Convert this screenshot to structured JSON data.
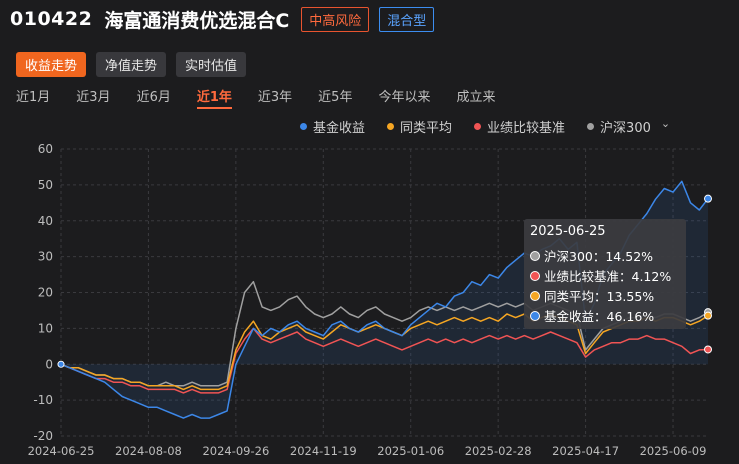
{
  "header": {
    "fund_code": "010422",
    "fund_name": "海富通消费优选混合C",
    "risk_tag": "中高风险",
    "type_tag": "混合型"
  },
  "view_buttons": [
    {
      "label": "收益走势",
      "active": true
    },
    {
      "label": "净值走势",
      "active": false
    },
    {
      "label": "实时估值",
      "active": false
    }
  ],
  "periods": [
    {
      "label": "近1月",
      "active": false
    },
    {
      "label": "近3月",
      "active": false
    },
    {
      "label": "近6月",
      "active": false
    },
    {
      "label": "近1年",
      "active": true
    },
    {
      "label": "近3年",
      "active": false
    },
    {
      "label": "近5年",
      "active": false
    },
    {
      "label": "今年以来",
      "active": false
    },
    {
      "label": "成立来",
      "active": false
    }
  ],
  "legend": [
    {
      "name": "基金收益",
      "color": "#3c87e8"
    },
    {
      "name": "同类平均",
      "color": "#f5a623"
    },
    {
      "name": "业绩比较基准",
      "color": "#f05454"
    },
    {
      "name": "沪深300",
      "color": "#a0a0a0"
    }
  ],
  "tooltip": {
    "date": "2025-06-25",
    "rows": [
      {
        "label": "沪深300：14.52%",
        "color": "#a0a0a0"
      },
      {
        "label": "业绩比较基准：4.12%",
        "color": "#f05454"
      },
      {
        "label": "同类平均：13.55%",
        "color": "#f5a623"
      },
      {
        "label": "基金收益：46.16%",
        "color": "#3c87e8"
      }
    ]
  },
  "chart_data": {
    "type": "line",
    "ylim": [
      -20,
      60
    ],
    "y_ticks": [
      60,
      50,
      40,
      30,
      20,
      10,
      0,
      -10,
      -20
    ],
    "x_tick_labels": [
      "2024-06-25",
      "2024-08-08",
      "2024-09-26",
      "2024-11-19",
      "2025-01-06",
      "2025-02-28",
      "2025-04-17",
      "2025-06-09"
    ],
    "x_tick_index": [
      0,
      10,
      20,
      30,
      40,
      50,
      60,
      70
    ],
    "n_points": 75,
    "series": [
      {
        "name": "基金收益",
        "color": "#3c87e8",
        "values": [
          0,
          -1,
          -2,
          -3,
          -4,
          -5,
          -7,
          -9,
          -10,
          -11,
          -12,
          -12,
          -13,
          -14,
          -15,
          -14,
          -15,
          -15,
          -14,
          -13,
          0,
          5,
          10,
          8,
          10,
          9,
          11,
          12,
          10,
          9,
          8,
          11,
          12,
          10,
          9,
          11,
          12,
          10,
          9,
          8,
          11,
          13,
          15,
          17,
          16,
          19,
          20,
          23,
          22,
          25,
          24,
          27,
          29,
          31,
          30,
          32,
          33,
          35,
          32,
          34,
          12,
          17,
          25,
          28,
          31,
          36,
          39,
          42,
          46,
          49,
          48,
          51,
          45,
          43,
          46.16
        ]
      },
      {
        "name": "同类平均",
        "color": "#f5a623",
        "values": [
          0,
          -1,
          -1,
          -2,
          -3,
          -3,
          -4,
          -4,
          -5,
          -5,
          -6,
          -6,
          -6,
          -6,
          -7,
          -6,
          -7,
          -7,
          -7,
          -6,
          4,
          9,
          12,
          8,
          7,
          9,
          10,
          11,
          9,
          8,
          7,
          9,
          11,
          10,
          9,
          10,
          11,
          10,
          9,
          8,
          10,
          11,
          12,
          11,
          12,
          13,
          12,
          13,
          12,
          13,
          12,
          14,
          13,
          14,
          12,
          13,
          14,
          13,
          12,
          11,
          3,
          6,
          9,
          10,
          11,
          12,
          12,
          13,
          12,
          13,
          13,
          12,
          11,
          12,
          13.55
        ]
      },
      {
        "name": "业绩比较基准",
        "color": "#f05454",
        "values": [
          0,
          -1,
          -2,
          -3,
          -4,
          -4,
          -5,
          -5,
          -6,
          -6,
          -7,
          -7,
          -7,
          -7,
          -8,
          -7,
          -8,
          -8,
          -8,
          -7,
          3,
          7,
          10,
          7,
          6,
          7,
          8,
          9,
          7,
          6,
          5,
          6,
          7,
          6,
          5,
          6,
          7,
          6,
          5,
          4,
          5,
          6,
          7,
          6,
          7,
          6,
          7,
          6,
          7,
          8,
          7,
          8,
          7,
          8,
          7,
          8,
          9,
          8,
          7,
          6,
          2,
          4,
          5,
          6,
          6,
          7,
          7,
          8,
          7,
          7,
          6,
          5,
          3,
          4,
          4.12
        ]
      },
      {
        "name": "沪深300",
        "color": "#a0a0a0",
        "values": [
          0,
          -1,
          -1,
          -2,
          -3,
          -3,
          -4,
          -4,
          -5,
          -5,
          -6,
          -6,
          -5,
          -6,
          -6,
          -5,
          -6,
          -6,
          -6,
          -5,
          10,
          20,
          23,
          16,
          15,
          16,
          18,
          19,
          16,
          14,
          13,
          14,
          16,
          14,
          13,
          15,
          16,
          14,
          13,
          12,
          13,
          15,
          16,
          15,
          16,
          15,
          16,
          15,
          16,
          17,
          16,
          17,
          16,
          17,
          15,
          16,
          17,
          16,
          15,
          14,
          4,
          7,
          10,
          11,
          12,
          13,
          13,
          14,
          13,
          14,
          14,
          13,
          12,
          13,
          14.52
        ]
      }
    ]
  }
}
